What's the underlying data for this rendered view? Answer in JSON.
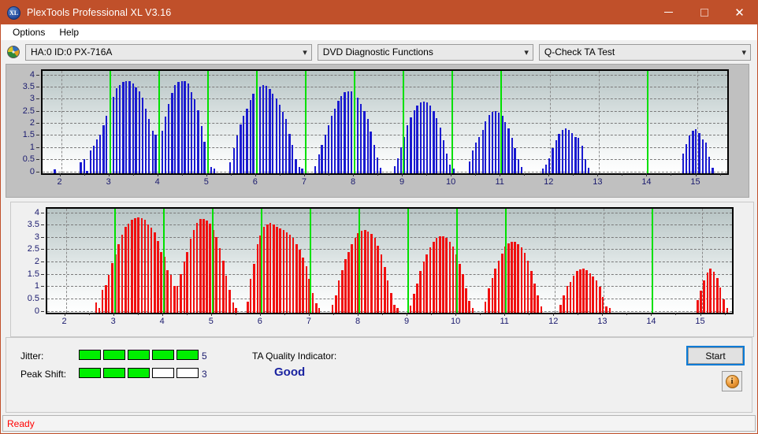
{
  "window": {
    "title": "PlexTools Professional XL V3.16",
    "icon": "xl-logo-icon",
    "minimize_label": "—",
    "maximize_label": "",
    "close_label": "✕"
  },
  "menu": {
    "items": [
      {
        "label": "Options"
      },
      {
        "label": "Help"
      }
    ]
  },
  "selectors": {
    "drive": {
      "icon": "disc-icon",
      "value": "HA:0 ID:0  PX-716A",
      "chevron": "⌄"
    },
    "function": {
      "value": "DVD Diagnostic Functions",
      "chevron": "⌄"
    },
    "test": {
      "value": "Q-Check TA Test",
      "chevron": "⌄"
    }
  },
  "results": {
    "jitter_label": "Jitter:",
    "jitter_value": "5",
    "jitter_filled": 5,
    "jitter_total": 5,
    "peak_shift_label": "Peak Shift:",
    "peak_shift_value": "3",
    "peak_shift_filled": 3,
    "peak_shift_total": 5,
    "ta_quality_label": "TA Quality Indicator:",
    "ta_quality_value": "Good",
    "start_label": "Start",
    "info_label": "i",
    "meter_on_color": "#00ef00",
    "meter_off_color": "#ffffff",
    "quality_color": "#1a23a0"
  },
  "status": {
    "text": "Ready",
    "color": "#ff0000"
  },
  "chart_data": [
    {
      "id": "ta-test-upper",
      "type": "bar",
      "title": "",
      "series_name": "TA Test (upper)",
      "color": "#1a1ad0",
      "xlabel": "",
      "ylabel": "",
      "xlim": [
        1.62,
        15.62
      ],
      "ylim": [
        -0.08,
        4.15
      ],
      "grid": true,
      "yticks": [
        0,
        0.5,
        1,
        1.5,
        2,
        2.5,
        3,
        3.5,
        4
      ],
      "ytick_labels": [
        "0",
        "0.5",
        "1",
        "1.5",
        "2",
        "2.5",
        "3",
        "3.5",
        "4"
      ],
      "xticks": [
        2,
        3,
        4,
        5,
        6,
        7,
        8,
        9,
        10,
        11,
        12,
        13,
        14,
        15
      ],
      "xtick_labels": [
        "2",
        "3",
        "4",
        "5",
        "6",
        "7",
        "8",
        "9",
        "10",
        "11",
        "12",
        "13",
        "14",
        "15"
      ],
      "vgridlines": [
        2,
        3,
        4,
        5,
        6,
        7,
        8,
        9,
        10,
        11,
        12,
        13,
        14,
        15
      ],
      "markers": [
        3,
        4,
        5,
        6,
        7,
        8,
        9,
        10,
        11,
        14
      ],
      "marker_color": "#00e000",
      "bar_step": 0.0667,
      "bar_width_frac": 0.55,
      "points": [
        [
          1.87,
          0.09
        ],
        [
          2.4,
          0.36
        ],
        [
          2.47,
          0.52
        ],
        [
          2.53,
          0.02
        ],
        [
          2.6,
          0.88
        ],
        [
          2.67,
          1.05
        ],
        [
          2.73,
          1.32
        ],
        [
          2.8,
          1.52
        ],
        [
          2.87,
          1.92
        ],
        [
          2.93,
          2.3
        ],
        [
          3.0,
          2.72
        ],
        [
          3.07,
          3.08
        ],
        [
          3.13,
          3.42
        ],
        [
          3.2,
          3.55
        ],
        [
          3.27,
          3.7
        ],
        [
          3.33,
          3.73
        ],
        [
          3.4,
          3.72
        ],
        [
          3.47,
          3.63
        ],
        [
          3.53,
          3.47
        ],
        [
          3.6,
          3.3
        ],
        [
          3.67,
          3.05
        ],
        [
          3.73,
          2.6
        ],
        [
          3.8,
          2.18
        ],
        [
          3.87,
          1.68
        ],
        [
          3.93,
          1.52
        ],
        [
          4.0,
          1.38
        ],
        [
          4.07,
          1.68
        ],
        [
          4.13,
          2.25
        ],
        [
          4.2,
          2.8
        ],
        [
          4.27,
          3.25
        ],
        [
          4.33,
          3.55
        ],
        [
          4.4,
          3.7
        ],
        [
          4.47,
          3.74
        ],
        [
          4.53,
          3.72
        ],
        [
          4.6,
          3.62
        ],
        [
          4.67,
          3.28
        ],
        [
          4.73,
          2.98
        ],
        [
          4.8,
          2.52
        ],
        [
          4.87,
          1.86
        ],
        [
          4.93,
          1.22
        ],
        [
          5.0,
          0.73
        ],
        [
          5.07,
          0.18
        ],
        [
          5.13,
          0.13
        ],
        [
          5.45,
          0.37
        ],
        [
          5.53,
          0.97
        ],
        [
          5.6,
          1.48
        ],
        [
          5.67,
          1.95
        ],
        [
          5.73,
          2.3
        ],
        [
          5.8,
          2.6
        ],
        [
          5.87,
          2.95
        ],
        [
          5.93,
          3.2
        ],
        [
          6.0,
          3.4
        ],
        [
          6.07,
          3.5
        ],
        [
          6.13,
          3.55
        ],
        [
          6.2,
          3.53
        ],
        [
          6.27,
          3.4
        ],
        [
          6.33,
          3.22
        ],
        [
          6.4,
          3.0
        ],
        [
          6.47,
          2.75
        ],
        [
          6.53,
          2.45
        ],
        [
          6.6,
          2.15
        ],
        [
          6.67,
          1.55
        ],
        [
          6.73,
          1.1
        ],
        [
          6.8,
          0.5
        ],
        [
          6.87,
          0.18
        ],
        [
          6.93,
          0.12
        ],
        [
          7.2,
          0.22
        ],
        [
          7.27,
          0.7
        ],
        [
          7.33,
          1.1
        ],
        [
          7.4,
          1.5
        ],
        [
          7.47,
          1.9
        ],
        [
          7.53,
          2.3
        ],
        [
          7.6,
          2.6
        ],
        [
          7.67,
          2.9
        ],
        [
          7.73,
          3.1
        ],
        [
          7.8,
          3.28
        ],
        [
          7.87,
          3.32
        ],
        [
          7.93,
          3.3
        ],
        [
          8.0,
          3.2
        ],
        [
          8.07,
          3.05
        ],
        [
          8.13,
          2.8
        ],
        [
          8.2,
          2.5
        ],
        [
          8.27,
          2.15
        ],
        [
          8.33,
          1.65
        ],
        [
          8.4,
          1.1
        ],
        [
          8.47,
          0.58
        ],
        [
          8.53,
          0.15
        ],
        [
          8.82,
          0.22
        ],
        [
          8.88,
          0.55
        ],
        [
          8.95,
          1.0
        ],
        [
          9.02,
          1.42
        ],
        [
          9.08,
          1.9
        ],
        [
          9.15,
          2.22
        ],
        [
          9.22,
          2.52
        ],
        [
          9.28,
          2.72
        ],
        [
          9.35,
          2.85
        ],
        [
          9.42,
          2.88
        ],
        [
          9.48,
          2.85
        ],
        [
          9.55,
          2.72
        ],
        [
          9.62,
          2.5
        ],
        [
          9.68,
          2.2
        ],
        [
          9.75,
          1.8
        ],
        [
          9.82,
          1.3
        ],
        [
          9.88,
          0.75
        ],
        [
          9.95,
          0.28
        ],
        [
          10.02,
          0.12
        ],
        [
          10.35,
          0.42
        ],
        [
          10.42,
          0.85
        ],
        [
          10.48,
          1.18
        ],
        [
          10.55,
          1.42
        ],
        [
          10.62,
          1.72
        ],
        [
          10.68,
          2.08
        ],
        [
          10.75,
          2.32
        ],
        [
          10.82,
          2.45
        ],
        [
          10.88,
          2.5
        ],
        [
          10.95,
          2.42
        ],
        [
          11.02,
          2.28
        ],
        [
          11.08,
          2.05
        ],
        [
          11.15,
          1.78
        ],
        [
          11.22,
          1.4
        ],
        [
          11.28,
          0.95
        ],
        [
          11.35,
          0.52
        ],
        [
          11.42,
          0.18
        ],
        [
          11.85,
          0.12
        ],
        [
          11.92,
          0.28
        ],
        [
          11.98,
          0.55
        ],
        [
          12.05,
          0.95
        ],
        [
          12.12,
          1.28
        ],
        [
          12.18,
          1.55
        ],
        [
          12.25,
          1.72
        ],
        [
          12.32,
          1.76
        ],
        [
          12.38,
          1.7
        ],
        [
          12.45,
          1.58
        ],
        [
          12.52,
          1.42
        ],
        [
          12.58,
          1.4
        ],
        [
          12.65,
          1.05
        ],
        [
          12.72,
          0.52
        ],
        [
          12.78,
          0.15
        ],
        [
          14.72,
          0.72
        ],
        [
          14.78,
          1.12
        ],
        [
          14.85,
          1.48
        ],
        [
          14.92,
          1.68
        ],
        [
          14.98,
          1.75
        ],
        [
          15.05,
          1.58
        ],
        [
          15.12,
          1.32
        ],
        [
          15.18,
          1.2
        ],
        [
          15.25,
          0.62
        ],
        [
          15.32,
          0.15
        ]
      ]
    },
    {
      "id": "ta-test-lower",
      "type": "bar",
      "title": "",
      "series_name": "TA Test (lower)",
      "color": "#f01010",
      "xlabel": "",
      "ylabel": "",
      "xlim": [
        1.62,
        15.62
      ],
      "ylim": [
        -0.08,
        4.15
      ],
      "grid": true,
      "yticks": [
        0,
        0.5,
        1,
        1.5,
        2,
        2.5,
        3,
        3.5,
        4
      ],
      "ytick_labels": [
        "0",
        "0.5",
        "1",
        "1.5",
        "2",
        "2.5",
        "3",
        "3.5",
        "4"
      ],
      "xticks": [
        2,
        3,
        4,
        5,
        6,
        7,
        8,
        9,
        10,
        11,
        12,
        13,
        14,
        15
      ],
      "xtick_labels": [
        "2",
        "3",
        "4",
        "5",
        "6",
        "7",
        "8",
        "9",
        "10",
        "11",
        "12",
        "13",
        "14",
        "15"
      ],
      "vgridlines": [
        2,
        3,
        4,
        5,
        6,
        7,
        8,
        9,
        10,
        11,
        12,
        13,
        14,
        15
      ],
      "markers": [
        3,
        4,
        5,
        6,
        7,
        8,
        9,
        10,
        11,
        14
      ],
      "marker_color": "#00e000",
      "bar_step": 0.0667,
      "bar_width_frac": 0.62,
      "points": [
        [
          2.62,
          0.34
        ],
        [
          2.68,
          0.12
        ],
        [
          2.75,
          0.85
        ],
        [
          2.82,
          1.05
        ],
        [
          2.88,
          1.45
        ],
        [
          2.95,
          1.95
        ],
        [
          3.02,
          2.3
        ],
        [
          3.08,
          2.7
        ],
        [
          3.15,
          3.1
        ],
        [
          3.22,
          3.4
        ],
        [
          3.28,
          3.55
        ],
        [
          3.35,
          3.7
        ],
        [
          3.42,
          3.78
        ],
        [
          3.48,
          3.8
        ],
        [
          3.55,
          3.78
        ],
        [
          3.62,
          3.7
        ],
        [
          3.68,
          3.52
        ],
        [
          3.75,
          3.38
        ],
        [
          3.82,
          3.2
        ],
        [
          3.88,
          2.85
        ],
        [
          3.95,
          2.4
        ],
        [
          4.02,
          2.18
        ],
        [
          4.08,
          1.65
        ],
        [
          4.15,
          1.45
        ],
        [
          4.22,
          1.02
        ],
        [
          4.28,
          1.02
        ],
        [
          4.35,
          1.5
        ],
        [
          4.42,
          2.0
        ],
        [
          4.48,
          2.4
        ],
        [
          4.55,
          2.92
        ],
        [
          4.62,
          3.28
        ],
        [
          4.68,
          3.58
        ],
        [
          4.75,
          3.72
        ],
        [
          4.82,
          3.74
        ],
        [
          4.88,
          3.68
        ],
        [
          4.95,
          3.55
        ],
        [
          5.02,
          3.3
        ],
        [
          5.08,
          3.0
        ],
        [
          5.15,
          2.55
        ],
        [
          5.22,
          2.02
        ],
        [
          5.28,
          1.42
        ],
        [
          5.35,
          0.85
        ],
        [
          5.42,
          0.35
        ],
        [
          5.48,
          0.12
        ],
        [
          5.72,
          0.38
        ],
        [
          5.78,
          1.3
        ],
        [
          5.85,
          1.92
        ],
        [
          5.92,
          2.72
        ],
        [
          5.98,
          3.05
        ],
        [
          6.05,
          3.4
        ],
        [
          6.12,
          3.52
        ],
        [
          6.18,
          3.57
        ],
        [
          6.25,
          3.52
        ],
        [
          6.32,
          3.42
        ],
        [
          6.38,
          3.35
        ],
        [
          6.45,
          3.3
        ],
        [
          6.52,
          3.18
        ],
        [
          6.58,
          3.1
        ],
        [
          6.65,
          2.95
        ],
        [
          6.72,
          2.72
        ],
        [
          6.78,
          2.5
        ],
        [
          6.85,
          2.15
        ],
        [
          6.92,
          1.8
        ],
        [
          6.98,
          1.3
        ],
        [
          7.05,
          0.72
        ],
        [
          7.12,
          0.3
        ],
        [
          7.18,
          0.12
        ],
        [
          7.45,
          0.25
        ],
        [
          7.52,
          0.62
        ],
        [
          7.58,
          1.22
        ],
        [
          7.65,
          1.65
        ],
        [
          7.72,
          2.1
        ],
        [
          7.78,
          2.38
        ],
        [
          7.85,
          2.7
        ],
        [
          7.92,
          2.95
        ],
        [
          7.98,
          3.15
        ],
        [
          8.05,
          3.25
        ],
        [
          8.12,
          3.28
        ],
        [
          8.18,
          3.22
        ],
        [
          8.25,
          3.12
        ],
        [
          8.32,
          2.95
        ],
        [
          8.38,
          2.65
        ],
        [
          8.45,
          2.3
        ],
        [
          8.52,
          1.78
        ],
        [
          8.58,
          1.25
        ],
        [
          8.65,
          0.72
        ],
        [
          8.72,
          0.25
        ],
        [
          8.78,
          0.12
        ],
        [
          9.05,
          0.22
        ],
        [
          9.12,
          0.68
        ],
        [
          9.18,
          1.12
        ],
        [
          9.25,
          1.62
        ],
        [
          9.32,
          2.0
        ],
        [
          9.38,
          2.3
        ],
        [
          9.45,
          2.58
        ],
        [
          9.52,
          2.8
        ],
        [
          9.58,
          2.95
        ],
        [
          9.65,
          3.02
        ],
        [
          9.72,
          3.02
        ],
        [
          9.78,
          2.95
        ],
        [
          9.85,
          2.82
        ],
        [
          9.92,
          2.6
        ],
        [
          9.98,
          2.3
        ],
        [
          10.05,
          1.92
        ],
        [
          10.12,
          1.48
        ],
        [
          10.18,
          0.92
        ],
        [
          10.25,
          0.4
        ],
        [
          10.32,
          0.12
        ],
        [
          10.58,
          0.38
        ],
        [
          10.65,
          0.92
        ],
        [
          10.72,
          1.32
        ],
        [
          10.78,
          1.7
        ],
        [
          10.85,
          2.02
        ],
        [
          10.92,
          2.32
        ],
        [
          10.98,
          2.62
        ],
        [
          11.05,
          2.75
        ],
        [
          11.12,
          2.82
        ],
        [
          11.18,
          2.8
        ],
        [
          11.25,
          2.72
        ],
        [
          11.32,
          2.58
        ],
        [
          11.38,
          2.35
        ],
        [
          11.45,
          2.02
        ],
        [
          11.52,
          1.62
        ],
        [
          11.58,
          1.12
        ],
        [
          11.65,
          0.62
        ],
        [
          11.72,
          0.18
        ],
        [
          12.12,
          0.25
        ],
        [
          12.18,
          0.62
        ],
        [
          12.25,
          1.0
        ],
        [
          12.32,
          1.18
        ],
        [
          12.38,
          1.42
        ],
        [
          12.45,
          1.62
        ],
        [
          12.52,
          1.68
        ],
        [
          12.58,
          1.72
        ],
        [
          12.65,
          1.65
        ],
        [
          12.72,
          1.52
        ],
        [
          12.78,
          1.38
        ],
        [
          12.85,
          1.25
        ],
        [
          12.92,
          0.98
        ],
        [
          12.98,
          0.55
        ],
        [
          13.05,
          0.18
        ],
        [
          13.12,
          0.1
        ],
        [
          14.92,
          0.42
        ],
        [
          14.98,
          0.82
        ],
        [
          15.05,
          1.25
        ],
        [
          15.12,
          1.55
        ],
        [
          15.18,
          1.72
        ],
        [
          15.25,
          1.6
        ],
        [
          15.32,
          1.32
        ],
        [
          15.38,
          0.95
        ],
        [
          15.45,
          0.48
        ],
        [
          15.52,
          0.12
        ]
      ]
    }
  ]
}
